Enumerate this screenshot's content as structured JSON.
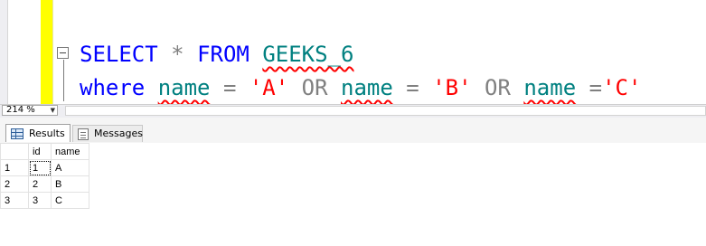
{
  "editor": {
    "line1": {
      "select": "SELECT",
      "star": "*",
      "from": "FROM",
      "table": "GEEKS_6"
    },
    "line2": {
      "where": "where",
      "name1": "name",
      "eq1": "=",
      "v1": "'A'",
      "or1": "OR",
      "name2": "name",
      "eq2": "=",
      "v2": "'B'",
      "or2": "OR",
      "name3": "name",
      "eq3": "=",
      "v3": "'C'"
    }
  },
  "zoom": {
    "value": "214 %"
  },
  "tabs": [
    {
      "label": "Results",
      "icon": "grid-icon",
      "active": true
    },
    {
      "label": "Messages",
      "icon": "messages-icon",
      "active": false
    }
  ],
  "grid": {
    "columns": [
      "id",
      "name"
    ],
    "rows": [
      {
        "num": "1",
        "id": "1",
        "name": "A"
      },
      {
        "num": "2",
        "id": "2",
        "name": "B"
      },
      {
        "num": "3",
        "id": "3",
        "name": "C"
      }
    ]
  },
  "colors": {
    "keyword": "#0000ff",
    "string": "#ff0000",
    "operator": "#808080",
    "object": "#008080",
    "margin": "#ffff00"
  }
}
